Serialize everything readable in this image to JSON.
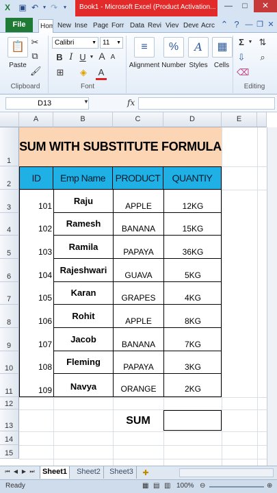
{
  "window": {
    "title": "Book1 - Microsoft Excel (Product Activation...",
    "minimize_glyph": "—",
    "restore_glyph": "□",
    "close_glyph": "✕"
  },
  "quick_access": {
    "save_icon": "save-icon",
    "undo_icon": "undo-icon",
    "redo_icon": "redo-icon"
  },
  "tabs": {
    "file": "File",
    "items": [
      "Hom",
      "New",
      "Inse",
      "Page",
      "Forr",
      "Data",
      "Revi",
      "Viev",
      "Deve",
      "Acrc"
    ]
  },
  "ribbon": {
    "clipboard": {
      "paste_label": "Paste",
      "group_label": "Clipboard"
    },
    "font": {
      "font_name": "Calibri",
      "font_size": "11",
      "bold": "B",
      "italic": "I",
      "underline": "U",
      "grow_font": "A",
      "shrink_font": "A",
      "font_color": "A",
      "group_label": "Font"
    },
    "alignment_label": "Alignment",
    "number_label": "Number",
    "styles_label": "Styles",
    "cells_label": "Cells",
    "editing_label": "Editing"
  },
  "formula_bar": {
    "name_box": "D13",
    "fx": "fx",
    "formula": ""
  },
  "columns": [
    "A",
    "B",
    "C",
    "D",
    "E"
  ],
  "rows": [
    "1",
    "2",
    "3",
    "4",
    "5",
    "6",
    "7",
    "8",
    "9",
    "10",
    "11",
    "12",
    "13",
    "14",
    "15"
  ],
  "sheet": {
    "title": "SUM WITH SUBSTITUTE FORMULA",
    "headers": [
      "ID",
      "Emp Name",
      "PRODUCT",
      "QUANTIY"
    ],
    "records": [
      {
        "id": "101",
        "name": "Raju",
        "product": "APPLE",
        "qty": "12KG"
      },
      {
        "id": "102",
        "name": "Ramesh",
        "product": "BANANA",
        "qty": "15KG"
      },
      {
        "id": "103",
        "name": "Ramila",
        "product": "PAPAYA",
        "qty": "36KG"
      },
      {
        "id": "104",
        "name": "Rajeshwari",
        "product": "GUAVA",
        "qty": "5KG"
      },
      {
        "id": "105",
        "name": "Karan",
        "product": "GRAPES",
        "qty": "4KG"
      },
      {
        "id": "106",
        "name": "Rohit",
        "product": "APPLE",
        "qty": "8KG"
      },
      {
        "id": "107",
        "name": "Jacob",
        "product": "BANANA",
        "qty": "7KG"
      },
      {
        "id": "108",
        "name": "Fleming",
        "product": "PAPAYA",
        "qty": "3KG"
      },
      {
        "id": "109",
        "name": "Navya",
        "product": "ORANGE",
        "qty": "2KG"
      }
    ],
    "sum_label": "SUM",
    "sum_value": ""
  },
  "sheet_tabs": [
    "Sheet1",
    "Sheet2",
    "Sheet3"
  ],
  "status": {
    "ready": "Ready",
    "zoom": "100%"
  }
}
